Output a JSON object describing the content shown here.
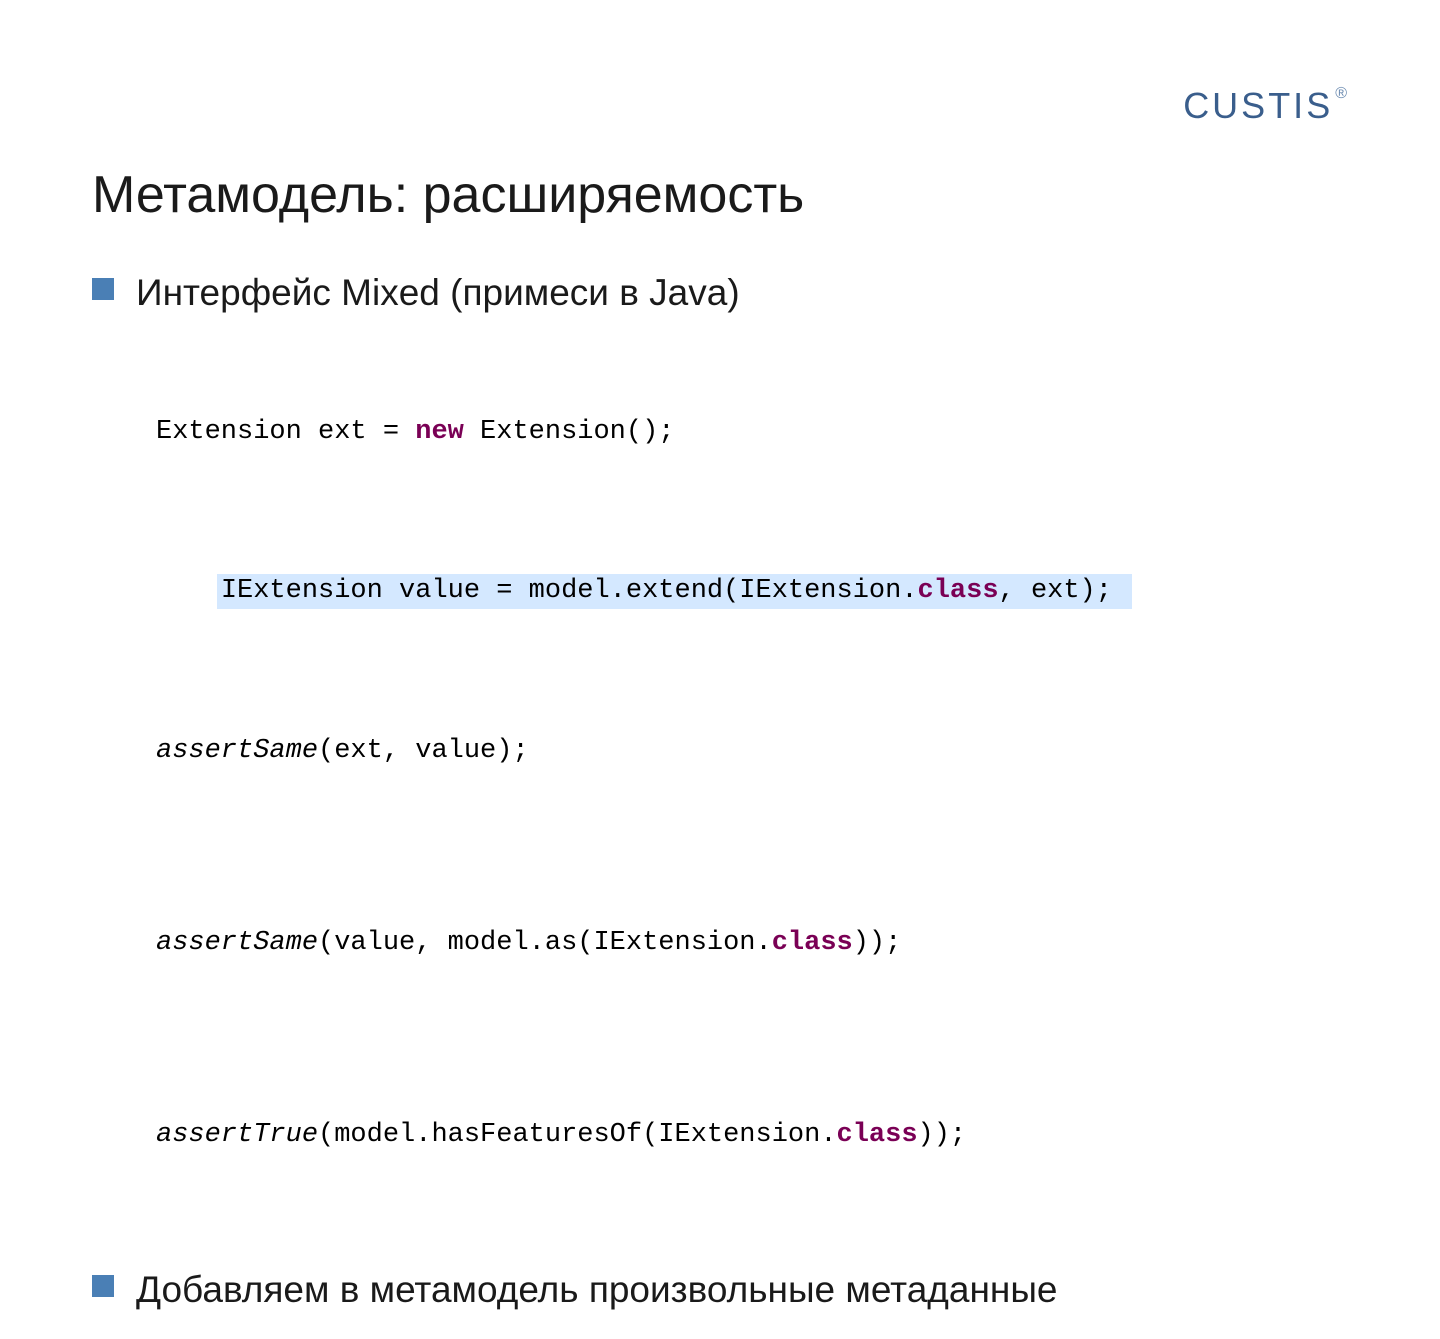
{
  "logo": {
    "text": "CUSTIS",
    "registered": "®"
  },
  "title": "Метамодель: расширяемость",
  "bullets": {
    "item1": "Интерфейс Mixed (примеси в Java)",
    "item2": "Добавляем в метамодель произвольные метаданные"
  },
  "code": {
    "line1_a": "Extension ext = ",
    "line1_kw": "new",
    "line1_b": " Extension();",
    "line2_a": "IExtension value = model.extend(IExtension.",
    "line2_kw": "class",
    "line2_b": ", ext);",
    "line3_fn": "assertSame",
    "line3_b": "(ext, value);",
    "line4_fn": "assertSame",
    "line4_b": "(value, model.as(IExtension.",
    "line4_kw": "class",
    "line4_c": "));",
    "line5_fn": "assertTrue",
    "line5_b": "(model.hasFeaturesOf(IExtension.",
    "line5_kw": "class",
    "line5_c": "));"
  }
}
